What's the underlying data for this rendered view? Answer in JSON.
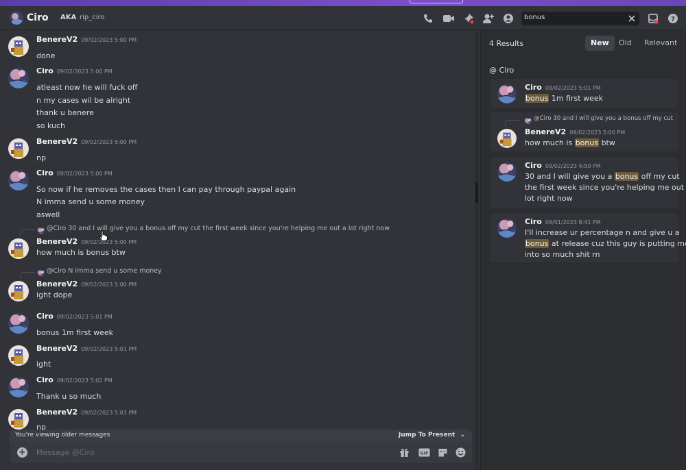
{
  "header": {
    "name": "Ciro",
    "aka_label": "AKA",
    "aka_value": "rip_ciro",
    "search_value": "bonus"
  },
  "chat": {
    "messages": [
      {
        "user": "BenereV2",
        "time": "09/02/2023 5:00 PM",
        "lines": [
          "done"
        ]
      },
      {
        "user": "Ciro",
        "time": "09/02/2023 5:00 PM",
        "lines": [
          "atleast now he will fuck off",
          "n my cases wil be alright",
          "thank u benere",
          "so kuch"
        ]
      },
      {
        "user": "BenereV2",
        "time": "09/02/2023 5:00 PM",
        "lines": [
          "np"
        ]
      },
      {
        "user": "Ciro",
        "time": "09/02/2023 5:00 PM",
        "lines": [
          "So now if he removes the cases then I can pay through paypal again",
          "N imma send u some money",
          "aswell"
        ]
      },
      {
        "user": "BenereV2",
        "time": "09/02/2023 5:00 PM",
        "reply": "@Ciro 30 and I will give you a bonus off my cut the first week since you're helping me out a lot right now",
        "lines": [
          "how much is bonus btw"
        ]
      },
      {
        "user": "BenereV2",
        "time": "09/02/2023 5:00 PM",
        "reply": "@Ciro N imma send u some money",
        "lines": [
          "ight dope"
        ]
      },
      {
        "user": "Ciro",
        "time": "09/02/2023 5:01 PM",
        "lines": [
          "bonus 1m first week"
        ]
      },
      {
        "user": "BenereV2",
        "time": "09/02/2023 5:01 PM",
        "lines": [
          "ight"
        ]
      },
      {
        "user": "Ciro",
        "time": "09/02/2023 5:02 PM",
        "lines": [
          "Thank u so much"
        ]
      },
      {
        "user": "BenereV2",
        "time": "09/02/2023 5:03 PM",
        "lines": [
          "np"
        ]
      }
    ],
    "older_text": "You're viewing older messages",
    "jump_label": "Jump To Present",
    "composer_placeholder": "Message @Ciro",
    "gif_label": "GIF"
  },
  "search_results": {
    "count": "4 Results",
    "tabs": [
      "New",
      "Old",
      "Relevant"
    ],
    "active_tab": "New",
    "channel": "@ Ciro",
    "cards": [
      {
        "user": "Ciro",
        "time": "09/02/2023 5:01 PM",
        "lines": [
          [
            "",
            "bonus",
            " 1m first week"
          ]
        ]
      },
      {
        "user": "BenereV2",
        "time": "09/02/2023 5:00 PM",
        "reply": "@Ciro 30 and I will give you a bonus off my cut",
        "lines": [
          [
            "how much is ",
            "bonus",
            " btw"
          ]
        ]
      },
      {
        "user": "Ciro",
        "time": "09/02/2023 4:50 PM",
        "lines": [
          [
            "30 and I will give you a ",
            "bonus",
            " off my cut"
          ],
          [
            "the first week since you're helping me out a",
            "",
            ""
          ],
          [
            "lot right now",
            "",
            ""
          ]
        ]
      },
      {
        "user": "Ciro",
        "time": "09/01/2023 8:41 PM",
        "lines": [
          [
            "I'll increase ur percentage n and give u a",
            "",
            ""
          ],
          [
            "",
            "bonus",
            " at release cuz this guy is putting me"
          ],
          [
            "into so much shit rn",
            "",
            ""
          ]
        ]
      }
    ]
  },
  "colors": {
    "background": "#313338",
    "sidebar": "#2b2d31",
    "highlight": "#6e5b3a",
    "accent_top": "#7a4fc9"
  }
}
